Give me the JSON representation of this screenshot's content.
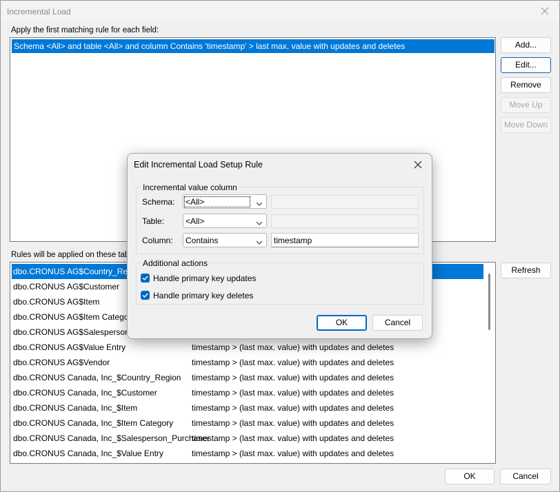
{
  "window": {
    "title": "Incremental Load"
  },
  "rules_section": {
    "label": "Apply the first matching rule for each field:",
    "rules": [
      "Schema <All> and table <All> and column Contains 'timestamp' > last max. value  with updates and deletes"
    ]
  },
  "side_buttons": {
    "add": "Add...",
    "edit": "Edit...",
    "remove": "Remove",
    "move_up": "Move Up",
    "move_down": "Move Down",
    "refresh": "Refresh"
  },
  "tables_section": {
    "label": "Rules will be applied on these tables",
    "rows": [
      {
        "name": "dbo.CRONUS AG$Country_Region",
        "rule": ""
      },
      {
        "name": "dbo.CRONUS AG$Customer",
        "rule": ""
      },
      {
        "name": "dbo.CRONUS AG$Item",
        "rule": ""
      },
      {
        "name": "dbo.CRONUS AG$Item Category",
        "rule": ""
      },
      {
        "name": "dbo.CRONUS AG$Salesperson_Pu",
        "rule": ""
      },
      {
        "name": "dbo.CRONUS AG$Value Entry",
        "rule": "timestamp > (last max. value) with updates and deletes"
      },
      {
        "name": "dbo.CRONUS AG$Vendor",
        "rule": "timestamp > (last max. value) with updates and deletes"
      },
      {
        "name": "dbo.CRONUS Canada, Inc_$Country_Region",
        "rule": "timestamp > (last max. value) with updates and deletes"
      },
      {
        "name": "dbo.CRONUS Canada, Inc_$Customer",
        "rule": "timestamp > (last max. value) with updates and deletes"
      },
      {
        "name": "dbo.CRONUS Canada, Inc_$Item",
        "rule": "timestamp > (last max. value) with updates and deletes"
      },
      {
        "name": "dbo.CRONUS Canada, Inc_$Item Category",
        "rule": "timestamp > (last max. value) with updates and deletes"
      },
      {
        "name": "dbo.CRONUS Canada, Inc_$Salesperson_Purchaser",
        "rule": "timestamp > (last max. value) with updates and deletes"
      },
      {
        "name": "dbo.CRONUS Canada, Inc_$Value Entry",
        "rule": "timestamp > (last max. value) with updates and deletes"
      }
    ]
  },
  "footer": {
    "ok": "OK",
    "cancel": "Cancel"
  },
  "dialog": {
    "title": "Edit Incremental Load Setup Rule",
    "group1_label": "Incremental value column",
    "schema_label": "Schema:",
    "schema_value": "<All>",
    "schema_text": "",
    "table_label": "Table:",
    "table_value": "<All>",
    "table_text": "",
    "column_label": "Column:",
    "column_value": "Contains",
    "column_text": "timestamp",
    "group2_label": "Additional actions",
    "check_updates": "Handle primary key updates",
    "check_deletes": "Handle primary key deletes",
    "ok": "OK",
    "cancel": "Cancel"
  },
  "colors": {
    "accent": "#0078d7",
    "checkbox": "#0067c0"
  }
}
